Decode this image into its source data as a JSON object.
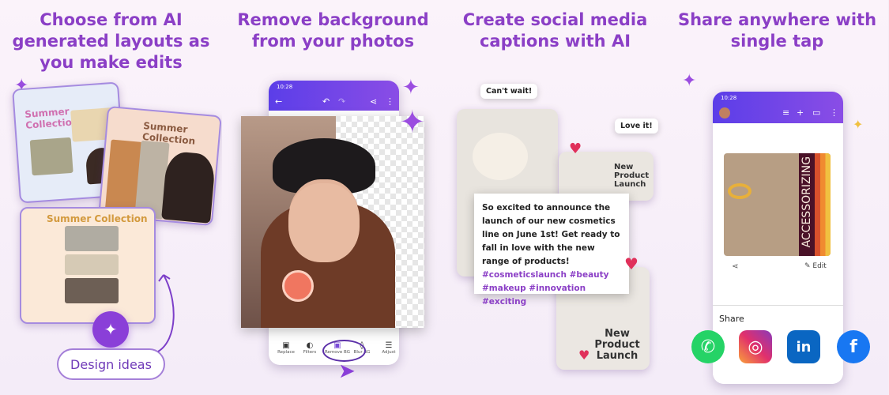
{
  "panels": [
    {
      "headline": "Choose from AI generated layouts as you make edits",
      "cards": [
        "Summer Collection",
        "Summer Collection",
        "Summer Collection"
      ],
      "button": "Design ideas"
    },
    {
      "headline": "Remove background from your photos",
      "status_time": "10:28",
      "tools": [
        {
          "label": "Replace",
          "icon": "image-icon"
        },
        {
          "label": "Filters",
          "icon": "filters-icon"
        },
        {
          "label": "Remove BG",
          "icon": "remove-bg-icon"
        },
        {
          "label": "Blur BG",
          "icon": "blur-icon"
        },
        {
          "label": "Adjust",
          "icon": "sliders-icon"
        }
      ],
      "active_tool": "Remove BG"
    },
    {
      "headline": "Create social media captions with AI",
      "reaction_1": "Can't wait!",
      "reaction_2": "Love it!",
      "card_text": "New Product Launch",
      "caption": "So excited to announce the launch of our new cosmetics line on June 1st! Get ready to fall in love with the new range of products!",
      "hashtags": "#cosmeticslaunch #beauty #makeup #innovation #exciting"
    },
    {
      "headline": "Share anywhere with single tap",
      "status_time": "10:28",
      "poster_text": "ACCESSORIZING",
      "edit_label": "Edit",
      "share_label": "Share",
      "share_targets": [
        "WhatsApp",
        "Instagram",
        "LinkedIn",
        "Facebook"
      ]
    }
  ],
  "colors": {
    "accent": "#8b3fc6",
    "appbar": "#6a44e8"
  }
}
